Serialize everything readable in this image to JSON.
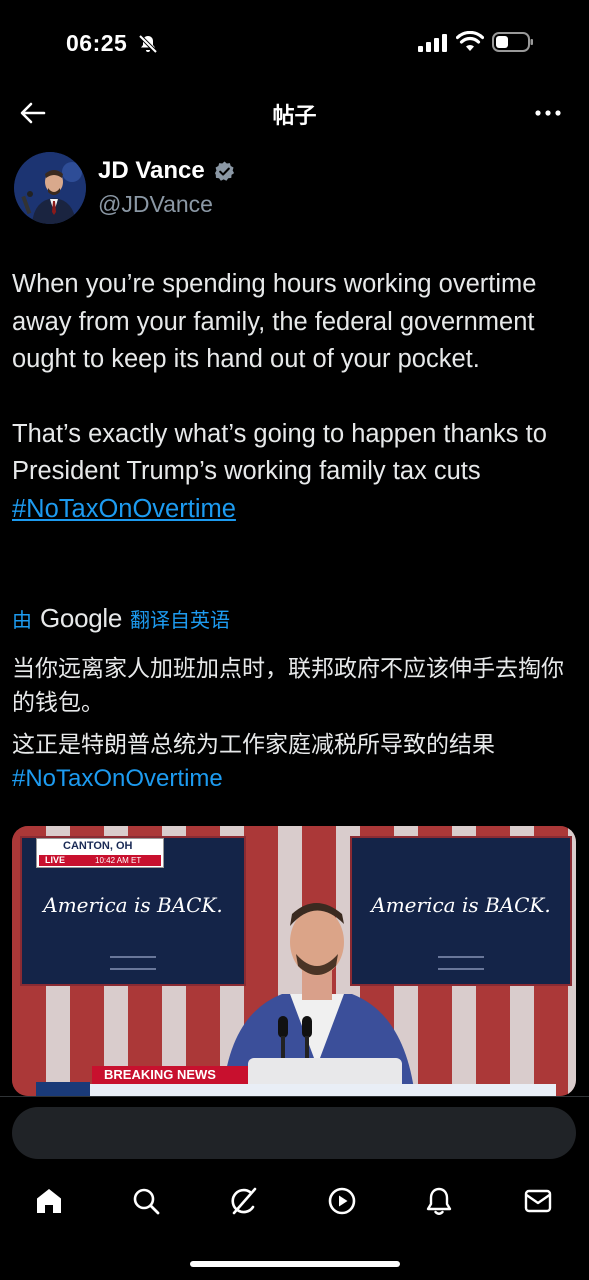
{
  "status_bar": {
    "time": "06:25"
  },
  "header": {
    "title": "帖子"
  },
  "author": {
    "name": "JD Vance",
    "handle": "@JDVance"
  },
  "tweet": {
    "paragraph1": "When you’re spending hours working overtime away from your family, the federal government ought to keep its hand out of your pocket.",
    "paragraph2_text": "That’s exactly what’s going to happen thanks to President Trump’s working family tax cuts ",
    "hashtag": "#NoTaxOnOvertime"
  },
  "translation": {
    "by": "由",
    "provider": "Google",
    "from": "翻译自英语",
    "paragraph1": "当你远离家人加班加点时，联邦政府不应该伸手去掏你的钱包。",
    "paragraph2_text": "这正是特朗普总统为工作家庭减税所导致的结果",
    "hashtag": "#NoTaxOnOvertime"
  },
  "media": {
    "banner_left": "America is BACK.",
    "banner_right": "America is BACK.",
    "dateline_place": "CANTON, OH",
    "live_label": "LIVE",
    "live_time": "10:42 AM ET",
    "breaking": "BREAKING NEWS"
  },
  "reply": {
    "placeholder": ""
  },
  "bottom_nav": {
    "items": [
      "home-icon",
      "search-icon",
      "grok-icon",
      "play-icon",
      "notifications-icon",
      "messages-icon"
    ]
  },
  "colors": {
    "accent": "#1d9bf0",
    "background": "#000000",
    "text": "#e7e9ea",
    "muted": "#8b98a5"
  }
}
